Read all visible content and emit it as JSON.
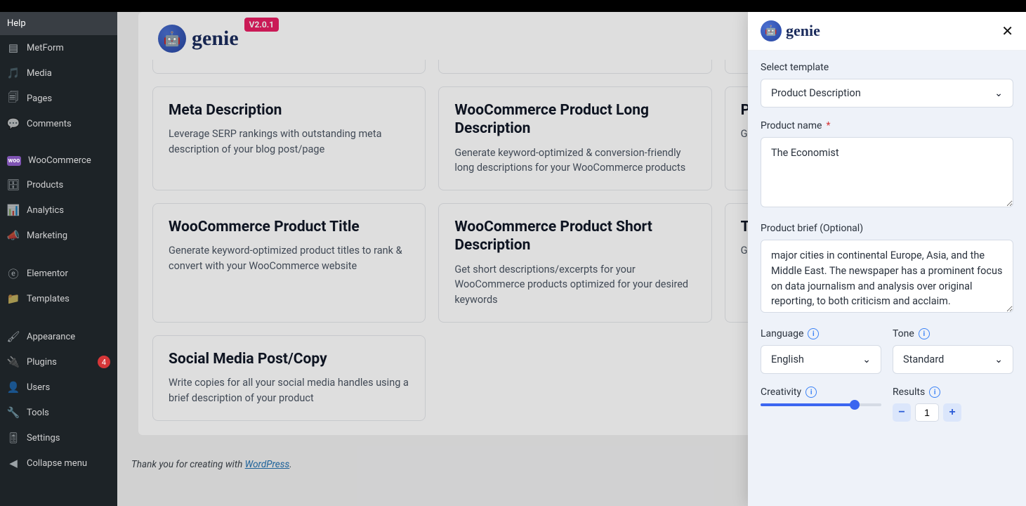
{
  "sidebar": {
    "items": [
      {
        "label": "Help",
        "icon": ""
      },
      {
        "label": "MetForm",
        "icon": "form"
      },
      {
        "label": "Media",
        "icon": "media"
      },
      {
        "label": "Pages",
        "icon": "pages"
      },
      {
        "label": "Comments",
        "icon": "comment"
      },
      {
        "label": "WooCommerce",
        "icon": "woo"
      },
      {
        "label": "Products",
        "icon": "products"
      },
      {
        "label": "Analytics",
        "icon": "analytics"
      },
      {
        "label": "Marketing",
        "icon": "marketing"
      },
      {
        "label": "Elementor",
        "icon": "elementor"
      },
      {
        "label": "Templates",
        "icon": "templates"
      },
      {
        "label": "Appearance",
        "icon": "appearance"
      },
      {
        "label": "Plugins",
        "icon": "plugins",
        "badge": "4"
      },
      {
        "label": "Users",
        "icon": "users"
      },
      {
        "label": "Tools",
        "icon": "tools"
      },
      {
        "label": "Settings",
        "icon": "settings"
      },
      {
        "label": "Collapse menu",
        "icon": "collapse"
      }
    ]
  },
  "logo": {
    "brand": "genie",
    "version": "V2.0.1"
  },
  "cards": [
    {
      "title": "Meta Description",
      "sub": "Leverage SERP rankings with outstanding meta description of your blog post/page"
    },
    {
      "title": "WooCommerce Product Long Description",
      "sub": "Generate keyword-optimized & conversion-friendly long descriptions for your WooCommerce products"
    },
    {
      "title": "Pro",
      "sub": "Gen\ntopi"
    },
    {
      "title": "WooCommerce Product Title",
      "sub": "Generate keyword-optimized product titles to rank & convert with your WooCommerce website"
    },
    {
      "title": "WooCommerce Product Short Description",
      "sub": "Get short descriptions/excerpts for your WooCommerce products optimized for your desired keywords"
    },
    {
      "title": "Tag",
      "sub": "Get\nproc"
    },
    {
      "title": "Social Media Post/Copy",
      "sub": "Write copies for all your social media handles using a brief description of your product"
    }
  ],
  "footer": {
    "pre": "Thank you for creating with ",
    "link": "WordPress",
    "post": "."
  },
  "drawer": {
    "template_label": "Select template",
    "template_value": "Product Description",
    "product_name_label": "Product name",
    "product_name_value": "The Economist",
    "brief_label": "Product brief (Optional)",
    "brief_value": "major cities in continental Europe, Asia, and the Middle East. The newspaper has a prominent focus on data journalism and analysis over original reporting, to both criticism and acclaim.",
    "language_label": "Language",
    "language_value": "English",
    "tone_label": "Tone",
    "tone_value": "Standard",
    "creativity_label": "Creativity",
    "results_label": "Results",
    "results_value": "1"
  }
}
